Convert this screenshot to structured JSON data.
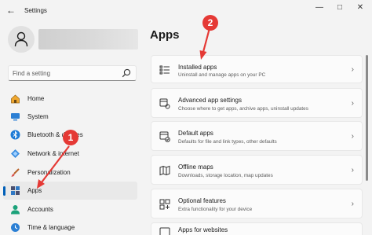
{
  "window": {
    "title": "Settings",
    "back_glyph": "←",
    "min_glyph": "—",
    "max_glyph": "□",
    "close_glyph": "✕"
  },
  "search": {
    "placeholder": "Find a setting"
  },
  "nav": {
    "items": [
      {
        "label": "Home",
        "icon": "home-icon"
      },
      {
        "label": "System",
        "icon": "system-icon"
      },
      {
        "label": "Bluetooth & devices",
        "icon": "bluetooth-icon"
      },
      {
        "label": "Network & internet",
        "icon": "network-icon"
      },
      {
        "label": "Personalization",
        "icon": "brush-icon"
      },
      {
        "label": "Apps",
        "icon": "apps-icon",
        "selected": true
      },
      {
        "label": "Accounts",
        "icon": "accounts-icon"
      },
      {
        "label": "Time & language",
        "icon": "time-language-icon"
      }
    ]
  },
  "main": {
    "title": "Apps",
    "cards": [
      {
        "title": "Installed apps",
        "subtitle": "Uninstall and manage apps on your PC",
        "icon": "installed-apps-icon"
      },
      {
        "title": "Advanced app settings",
        "subtitle": "Choose where to get apps, archive apps, uninstall updates",
        "icon": "advanced-app-settings-icon"
      },
      {
        "title": "Default apps",
        "subtitle": "Defaults for file and link types, other defaults",
        "icon": "default-apps-icon"
      },
      {
        "title": "Offline maps",
        "subtitle": "Downloads, storage location, map updates",
        "icon": "offline-maps-icon"
      },
      {
        "title": "Optional features",
        "subtitle": "Extra functionality for your device",
        "icon": "optional-features-icon"
      },
      {
        "title": "Apps for websites",
        "subtitle": "",
        "icon": "apps-for-websites-icon"
      }
    ],
    "chevron": "›"
  },
  "annotations": {
    "callout_1": "1",
    "callout_2": "2"
  },
  "colors": {
    "accent": "#005fb8",
    "callout": "#e53935",
    "background": "#f3f3f3",
    "card": "#fbfbfb"
  }
}
